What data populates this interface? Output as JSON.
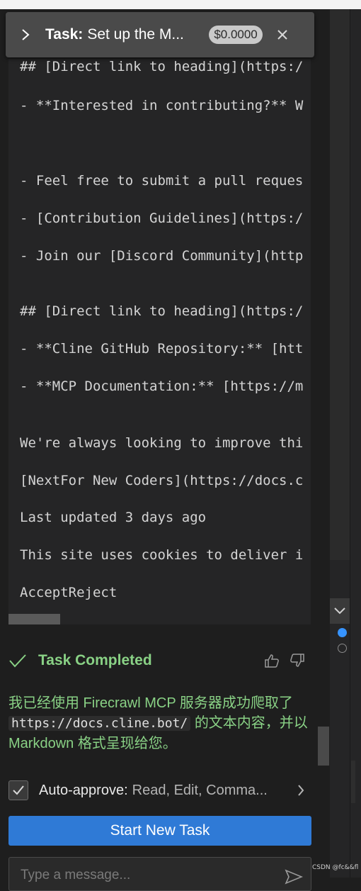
{
  "task_header": {
    "label": "Task:",
    "title": "Set up the M...",
    "cost": "$0.0000"
  },
  "code_lines": [
    "## [Direct link to heading](https:/",
    "- **Interested in contributing?** W",
    "- Feel free to submit a pull reques",
    "- [Contribution Guidelines](https:/",
    "- Join our [Discord Community](http",
    "## [Direct link to heading](https:/",
    "- **Cline GitHub Repository:** [htt",
    "- **MCP Documentation:** [https://m",
    "We're always looking to improve thi",
    "[NextFor New Coders](https://docs.c",
    "Last updated 3 days ago",
    "This site uses cookies to deliver i",
    "AcceptReject"
  ],
  "completion": {
    "status": "Task Completed",
    "result_part1": "我已经使用 Firecrawl MCP 服务器成功爬取了",
    "result_url": "https://docs.cline.bot/",
    "result_part2": "的文本内容，并以 Markdown 格式呈现给您。"
  },
  "auto_approve": {
    "label": "Auto-approve:",
    "value": "Read, Edit, Comma..."
  },
  "new_task_button": "Start New Task",
  "message_input": {
    "placeholder": "Type a message..."
  },
  "watermark": "CSDN @fc&&fl",
  "colors": {
    "accent_blue": "#2f7ad6",
    "success_green": "#89d185",
    "background": "#1e1e1e"
  }
}
